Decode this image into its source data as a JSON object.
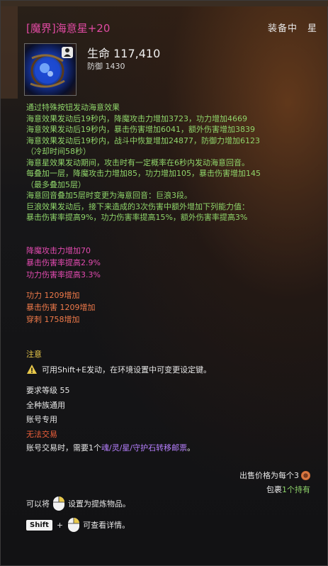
{
  "item": {
    "title": "[魔界]海意星+20",
    "equipped": "装备中　星"
  },
  "stats": {
    "main": "生命 117,410",
    "sub": "防御 1430"
  },
  "description": [
    "通过特殊按钮发动海意效果",
    "海意效果发动后19秒内，降魔攻击力增加3723，功力增加4669",
    "海意效果发动后19秒内，暴击伤害增加6041，额外伤害增加3839",
    "海意效果发动后19秒内，战斗中恢复增加24877，防御力增加6123",
    "（冷却时间58秒）",
    "海意星效果发动期间，攻击时有一定概率在6秒内发动海意回音。",
    "每叠加一层，降魔攻击力增加85，功力增加105，暴击伤害增加145",
    "（最多叠加5层）",
    "海意回音叠加5层时变更为海意回音：巨浪3段。",
    "巨浪效果发动后，接下来造成的3次伤害中额外增加下列能力值：",
    "暴击伤害率提高9%，功力伤害率提高15%，额外伤害率提高3%"
  ],
  "bonus_pink": [
    "降魔攻击力增加70",
    "暴击伤害率提高2.9%",
    "功力伤害率提高3.3%"
  ],
  "bonus_orange": [
    "功力 1209增加",
    "暴击伤害 1209增加",
    "穿刺 1758增加"
  ],
  "notice": {
    "title": "注意",
    "text": "可用Shift+E发动，在环境设置中可变更设定键。"
  },
  "requirements": {
    "level": "要求等级 55",
    "race": "全种族通用",
    "account": "账号专用",
    "trade": "无法交易"
  },
  "mail": {
    "prefix": "账号交易时，需要1个",
    "item": "魂/灵/星/守护石转移邮票",
    "suffix": "。"
  },
  "sell": {
    "text": "出售价格为每个3"
  },
  "bag": {
    "prefix": "包裹",
    "count": "1个持有"
  },
  "refine": {
    "prefix": "可以将",
    "suffix": "设置为提炼物品。"
  },
  "detail": {
    "key": "Shift",
    "plus": "+",
    "suffix": "可查看详情。"
  },
  "colors": {
    "title": "#e04aa2",
    "effect": "#8fd46a",
    "pink_bonus": "#e34bb0",
    "orange_bonus": "#f07a4a",
    "notice": "#e8c84a",
    "untradeable": "#f0603c",
    "mail_item": "#b780ff"
  },
  "icons": {
    "item_icon": "blue-star-orb-icon",
    "account_icon": "person-icon",
    "warning": "warning-icon",
    "coin": "copper-coin-icon",
    "mouse": "right-click-mouse-icon"
  }
}
